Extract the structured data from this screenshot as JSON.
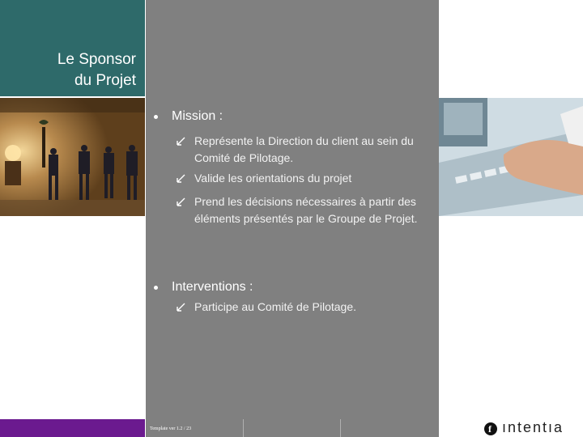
{
  "header": {
    "title_line1": "Le Sponsor",
    "title_line2": "du Projet"
  },
  "sections": [
    {
      "label": "Mission :",
      "items": [
        "Représente la Direction du client au sein du Comité de Pilotage.",
        "Valide les orientations du projet",
        "Prend les décisions nécessaires à partir des éléments présentés par le Groupe de Projet."
      ]
    },
    {
      "label": "Interventions  :",
      "items": [
        "Participe au Comité de Pilotage."
      ]
    }
  ],
  "footer": {
    "template_version": "Template ver 1.2 / 23",
    "logo_text": "ıntentıa"
  },
  "colors": {
    "title_bg": "#2e6a6a",
    "content_bg": "#808080",
    "footer_accent": "#6b1a8f"
  }
}
